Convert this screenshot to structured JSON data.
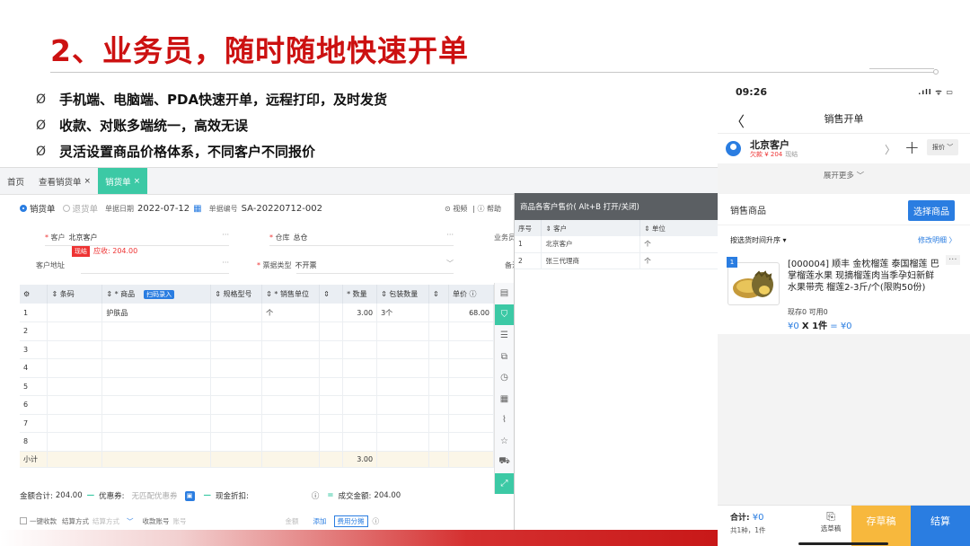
{
  "slide": {
    "title": "2、业务员，随时随地快速开单",
    "bullet_mark": "Ø",
    "bullets": [
      "手机端、电脑端、PDA快速开单，远程打印，及时发货",
      "收款、对账多端统一，高效无误",
      "灵活设置商品价格体系，不同客户不同报价"
    ]
  },
  "desktop": {
    "tabs": {
      "home": "首页",
      "view": "查看销货单",
      "sale": "销货单",
      "close": "×"
    },
    "doc_type": {
      "sale": "销货单",
      "return": "退货单"
    },
    "date_label": "单据日期",
    "date_value": "2022-07-12",
    "docno_label": "单据编号",
    "docno_value": "SA-20220712-002",
    "video_link": "⊙ 视频",
    "help_link": "| ⓘ 帮助",
    "fields": {
      "customer_label": "客户",
      "customer_value": "北京客户",
      "warehouse_label": "仓库",
      "warehouse_value": "总仓",
      "salesman_label": "业务员",
      "address_label": "客户地址",
      "invoice_label": "票据类型",
      "invoice_value": "不开票",
      "remark_label": "备注",
      "cash_badge": "现结",
      "debt": "应收: 204.00"
    },
    "grid": {
      "headers": [
        "",
        "⇕ 条码",
        "⇕ * 商品",
        "⇕ 规格型号",
        "⇕ * 销售单位",
        "⇕",
        "* 数量",
        "⇕ 包装数量",
        "⇕",
        "单价 ⓘ"
      ],
      "scan_label": "扫码录入",
      "rows": [
        {
          "no": "1",
          "product": "护肤品",
          "unit": "个",
          "qty": "3.00",
          "pack": "3个",
          "price": "68.00"
        },
        {
          "no": "2",
          "product": "",
          "unit": "",
          "qty": "",
          "pack": "",
          "price": ""
        },
        {
          "no": "3",
          "product": "",
          "unit": "",
          "qty": "",
          "pack": "",
          "price": ""
        },
        {
          "no": "4",
          "product": "",
          "unit": "",
          "qty": "",
          "pack": "",
          "price": ""
        },
        {
          "no": "5",
          "product": "",
          "unit": "",
          "qty": "",
          "pack": "",
          "price": ""
        },
        {
          "no": "6",
          "product": "",
          "unit": "",
          "qty": "",
          "pack": "",
          "price": ""
        },
        {
          "no": "7",
          "product": "",
          "unit": "",
          "qty": "",
          "pack": "",
          "price": ""
        },
        {
          "no": "8",
          "product": "",
          "unit": "",
          "qty": "",
          "pack": "",
          "price": ""
        }
      ],
      "subtotal_label": "小计",
      "subtotal_qty": "3.00"
    },
    "summary": {
      "total_label": "金额合计:",
      "total_value": "204.00",
      "coupon_label": "优惠券:",
      "coupon_placeholder": "无匹配优惠券",
      "discount_label": "现金折扣:",
      "deal_label": "成交金额:",
      "deal_value": "204.00"
    },
    "pay": {
      "onekey": "一键收款",
      "method_label": "结算方式",
      "method_placeholder": "结算方式",
      "account_label": "收款账号",
      "account_placeholder": "账号",
      "amount_label": "金额",
      "add": "添加",
      "split": "费用分摊"
    },
    "panel": {
      "title": "商品各客户售价( Alt+B 打开/关闭)",
      "headers": [
        "序号",
        "⇕ 客户",
        "⇕ 单位"
      ],
      "rows": [
        {
          "no": "1",
          "customer": "北京客户",
          "unit": "个"
        },
        {
          "no": "2",
          "customer": "张三代理商",
          "unit": "个"
        }
      ]
    }
  },
  "phone": {
    "time": "09:26",
    "signal": ".ıll ᯤ ▭",
    "title": "销售开单",
    "customer_name": "北京客户",
    "owe": "欠款 ¥ 204",
    "owe_cash": "现结",
    "price_btn": "报价 ﹀",
    "expand": "展开更多 ﹀",
    "goods_label": "销售商品",
    "select_goods": "选择商品",
    "sort_label": "按选货时间升序 ▾",
    "edit_detail": "修改明细 〉",
    "item_index": "1",
    "item_name": "[000004] 顺丰 金枕榴莲 泰国榴莲 巴掌榴莲水果 现摘榴莲肉当季孕妇新鲜水果带壳 榴莲2-3斤/个(限购50份)",
    "item_more": "···",
    "stock": "现存0   可用0",
    "calc_price": "¥0",
    "calc_qty": "X 1件",
    "calc_total": "= ¥0",
    "total_label": "合计: ",
    "total_value": "¥0",
    "count": "共1种，1件",
    "draft_select": "选草稿",
    "save_draft": "存草稿",
    "checkout": "结算"
  },
  "colors": {
    "title_red": "#cc1111",
    "tab_green": "#3cc9a5",
    "accent_blue": "#2a7de1",
    "draft_yellow": "#f7b83d"
  }
}
